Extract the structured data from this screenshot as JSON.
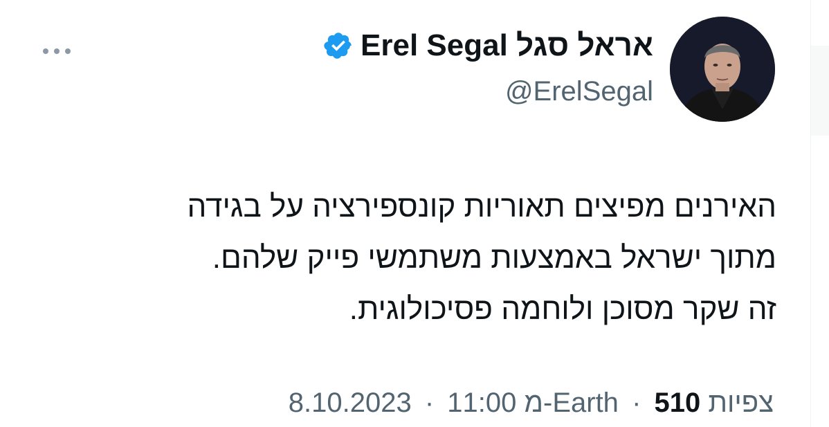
{
  "author": {
    "display_name": "Erel Segal אראל סגל",
    "handle": "@ErelSegal",
    "verified": true,
    "verified_color": "#1d9bf0"
  },
  "tweet": {
    "lines": [
      "האירנים מפיצים תאוריות קונספירציה על בגידה",
      "מתוך ישראל באמצעות משתמשי פייק שלהם.",
      "זה שקר מסוכן ולוחמה פסיכולוגית."
    ]
  },
  "meta": {
    "date": "8.10.2023",
    "time": "11:00 מ-Earth",
    "separator": "·",
    "views_count": "510",
    "views_label": "צפיות"
  },
  "icons": {
    "more": "more-dots-icon",
    "verified": "verified-badge-icon",
    "avatar": "avatar-photo"
  },
  "colors": {
    "text_primary": "#0f1419",
    "text_secondary": "#536471",
    "background": "#ffffff"
  }
}
